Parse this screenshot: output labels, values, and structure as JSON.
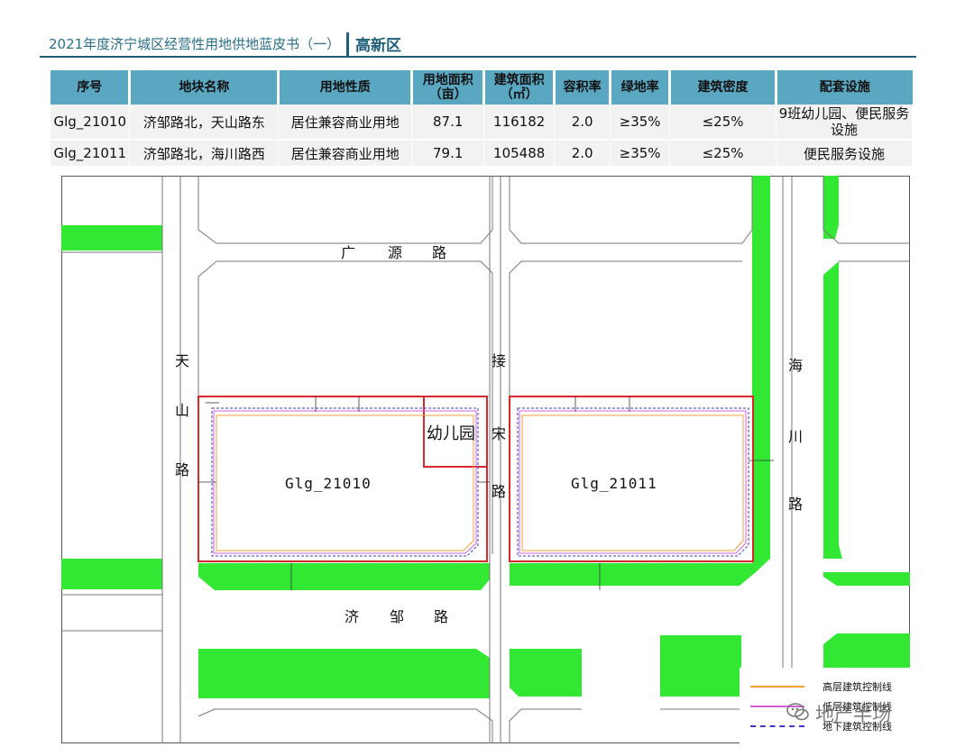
{
  "header": {
    "title": "2021年度济宁城区经营性用地供地蓝皮书（一）",
    "district": "高新区"
  },
  "table": {
    "headers": [
      "序号",
      "地块名称",
      "用地性质",
      "用地面积（亩）",
      "建筑面积（㎡）",
      "容积率",
      "绿地率",
      "建筑密度",
      "配套设施"
    ],
    "header_lines": [
      [
        "序号"
      ],
      [
        "地块名称"
      ],
      [
        "用地性质"
      ],
      [
        "用地面积",
        "（亩）"
      ],
      [
        "建筑面积",
        "（㎡）"
      ],
      [
        "容积率"
      ],
      [
        "绿地率"
      ],
      [
        "建筑密度"
      ],
      [
        "配套设施"
      ]
    ],
    "rows": [
      [
        "Glg_21010",
        "济邹路北，天山路东",
        "居住兼容商业用地",
        "87.1",
        "116182",
        "2.0",
        "≥35%",
        "≤25%",
        "9班幼儿园、便民服务设施"
      ],
      [
        "Glg_21011",
        "济邹路北，海川路西",
        "居住兼容商业用地",
        "79.1",
        "105488",
        "2.0",
        "≥35%",
        "≤25%",
        "便民服务设施"
      ]
    ],
    "row1_facilities_lines": [
      "9班幼儿园、便民服务",
      "设施"
    ]
  },
  "map": {
    "roads": {
      "guangyuan": [
        "广",
        "源",
        "路"
      ],
      "tianshan": [
        "天",
        "山",
        "路"
      ],
      "jiesong": [
        "接",
        "宋",
        "路"
      ],
      "haichuan": [
        "海",
        "川",
        "路"
      ],
      "jizou": [
        "济",
        "邹",
        "路"
      ]
    },
    "parcels": [
      "Glg_21010",
      "Glg_21011"
    ],
    "kindergarten": "幼儿园",
    "dimensions": [
      "5.0",
      "10.0",
      "18.0",
      "15.0",
      "20.0",
      "8.0",
      "12.0",
      "10.0",
      "25.0",
      "10.0"
    ],
    "colors": {
      "green": "#33e833",
      "parcel_red": "#d8282c",
      "high_rise_line": "#f0a03c",
      "low_rise_line": "#d060d8",
      "underground_line": "#3a3ac8",
      "road_edge": "#777777"
    }
  },
  "legend": {
    "items": [
      {
        "label": "高层建筑控制线",
        "color": "#f0a03c",
        "style": "solid"
      },
      {
        "label": "低层建筑控制线",
        "color": "#d060d8",
        "style": "solid"
      },
      {
        "label": "地下建筑控制线",
        "color": "#3a3ac8",
        "style": "dashed"
      }
    ]
  },
  "watermark": {
    "text": "地产半场",
    "icon": "wechat-icon"
  }
}
